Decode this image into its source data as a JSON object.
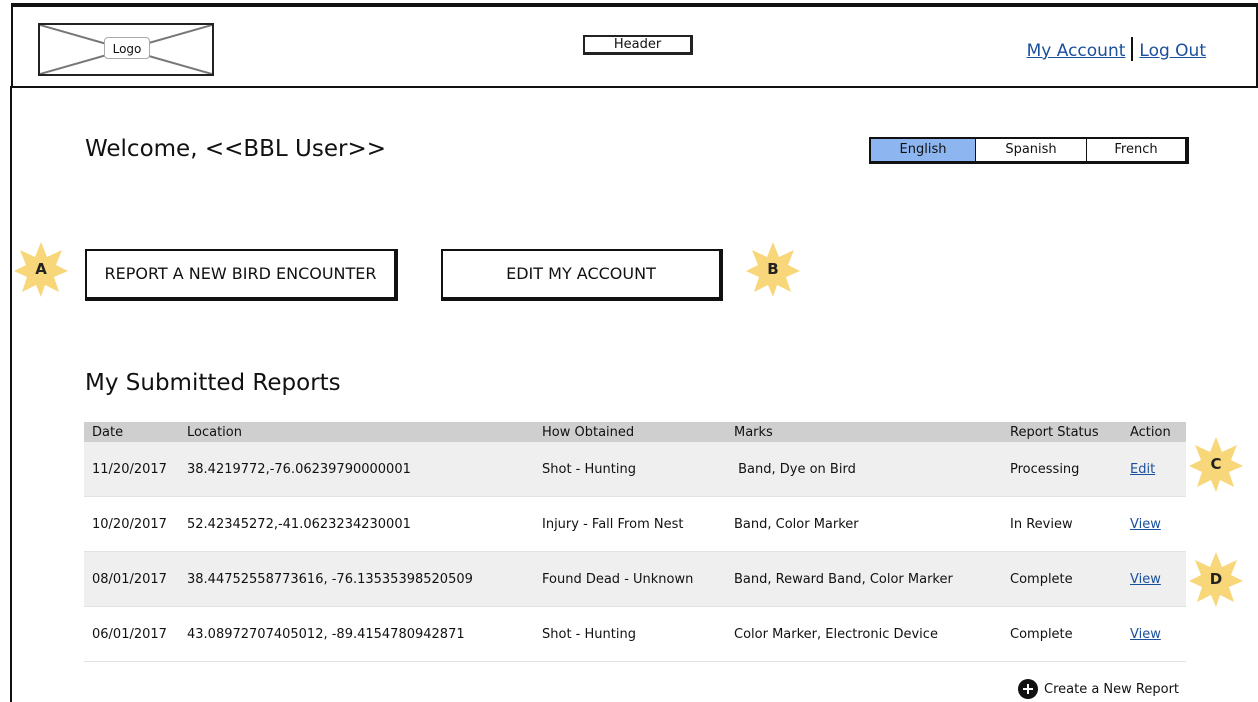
{
  "header": {
    "logo_label": "Logo",
    "header_label": "Header",
    "my_account": "My Account",
    "log_out": "Log Out"
  },
  "welcome": "Welcome, <<BBL User>>",
  "languages": {
    "english": "English",
    "spanish": "Spanish",
    "french": "French",
    "selected": "English"
  },
  "buttons": {
    "report_new": "REPORT A NEW BIRD ENCOUNTER",
    "edit_account": "EDIT MY ACCOUNT"
  },
  "callouts": {
    "a": "A",
    "b": "B",
    "c": "C",
    "d": "D"
  },
  "reports": {
    "title": "My Submitted Reports",
    "columns": {
      "date": "Date",
      "location": "Location",
      "how": "How Obtained",
      "marks": "Marks",
      "status": "Report Status",
      "action": "Action"
    },
    "rows": [
      {
        "date": "11/20/2017",
        "location": "38.4219772,-76.06239790000001",
        "how": "Shot - Hunting",
        "marks": " Band, Dye on Bird",
        "status": "Processing",
        "action": "Edit"
      },
      {
        "date": "10/20/2017",
        "location": "52.42345272,-41.0623234230001",
        "how": "Injury - Fall From Nest",
        "marks": "Band, Color Marker",
        "status": "In Review",
        "action": "View"
      },
      {
        "date": "08/01/2017",
        "location": "38.44752558773616, -76.13535398520509",
        "how": "Found Dead - Unknown",
        "marks": "Band, Reward Band, Color Marker",
        "status": "Complete",
        "action": "View"
      },
      {
        "date": "06/01/2017",
        "location": "43.08972707405012, -89.4154780942871",
        "how": "Shot - Hunting",
        "marks": "Color Marker, Electronic Device",
        "status": "Complete",
        "action": "View"
      }
    ],
    "create_new": "Create a New Report"
  },
  "colors": {
    "link": "#1a4f9c",
    "selected_language": "#8db6f0",
    "callout_star": "#f8d77a",
    "table_header": "#cfcfcf",
    "row_shade": "#efefef"
  }
}
